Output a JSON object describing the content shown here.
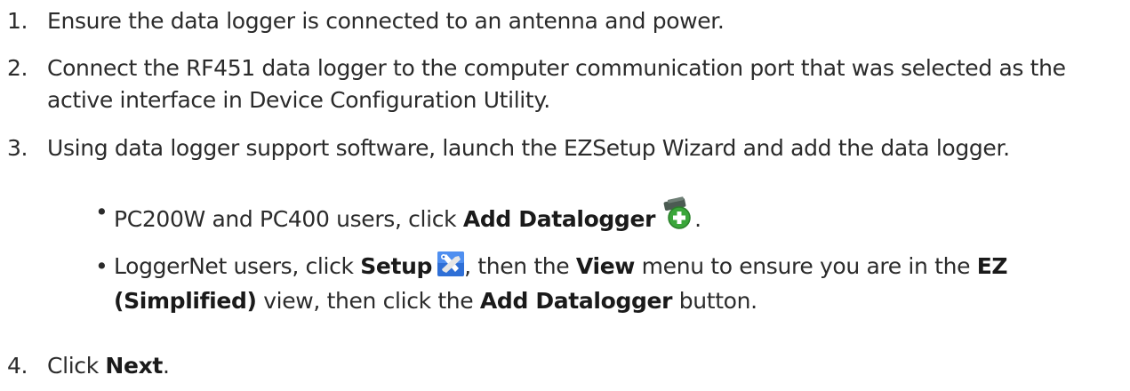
{
  "steps": [
    {
      "number": "1.",
      "text": "Ensure the data logger is connected to an antenna and power."
    },
    {
      "number": "2.",
      "text": "Connect the RF451 data logger to the computer communication port that was selected as the active interface in Device Configuration Utility."
    },
    {
      "number": "3.",
      "text": "Using data logger support software, launch the EZSetup Wizard and add the data logger.",
      "bullets": [
        {
          "before": "PC200W and PC400 users, click ",
          "bold1": "Add Datalogger",
          "icon": "add-datalogger-icon",
          "after": "."
        },
        {
          "before": "LoggerNet users, click ",
          "bold1": "Setup",
          "icon": "setup-icon",
          "mid1": ", then the ",
          "bold2": "View",
          "mid2": " menu to ensure you are in the ",
          "bold3": "EZ (Simplified)",
          "mid3": " view, then click the ",
          "bold4": "Add Datalogger",
          "after": " button."
        }
      ]
    },
    {
      "number": "4.",
      "before": "Click ",
      "bold": "Next",
      "after": "."
    }
  ],
  "colors": {
    "text": "#2b2b2b",
    "add_icon_green": "#3aa63a",
    "setup_icon_blue": "#2f6fd6"
  }
}
